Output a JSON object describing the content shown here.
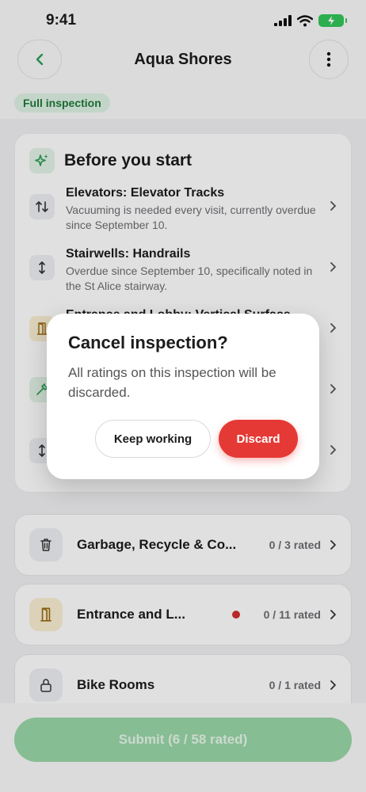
{
  "status": {
    "time": "9:41"
  },
  "header": {
    "title": "Aqua Shores"
  },
  "tag": "Full inspection",
  "before_start": {
    "title": "Before you start",
    "items": [
      {
        "title": "Elevators: Elevator Tracks",
        "desc": "Vacuuming is needed every visit, currently overdue since September 10.",
        "icon": "arrows-up-down-icon"
      },
      {
        "title": "Stairwells: Handrails",
        "desc": "Overdue since September 10, specifically noted in the St Alice stairway.",
        "icon": "arrow-vertical-icon"
      },
      {
        "title": "Entrance and Lobby: Vertical Surface",
        "desc": "",
        "icon": "door-icon"
      },
      {
        "title": "",
        "desc": "",
        "icon": "tools-icon"
      },
      {
        "title": "",
        "desc": "",
        "icon": "arrow-vertical-icon"
      }
    ]
  },
  "areas": [
    {
      "label": "Garbage, Recycle & Co...",
      "count": "0 / 3 rated",
      "icon": "trash-icon",
      "flag": false
    },
    {
      "label": "Entrance and L...",
      "count": "0 / 11 rated",
      "icon": "door-icon",
      "flag": true
    },
    {
      "label": "Bike Rooms",
      "count": "0 / 1 rated",
      "icon": "lock-icon",
      "flag": false
    }
  ],
  "submit": {
    "label": "Submit (6 / 58 rated)"
  },
  "dialog": {
    "title": "Cancel inspection?",
    "body": "All ratings on this inspection will be discarded.",
    "keep_label": "Keep working",
    "discard_label": "Discard"
  },
  "colors": {
    "accent_green": "#34c759",
    "danger": "#e53935"
  }
}
